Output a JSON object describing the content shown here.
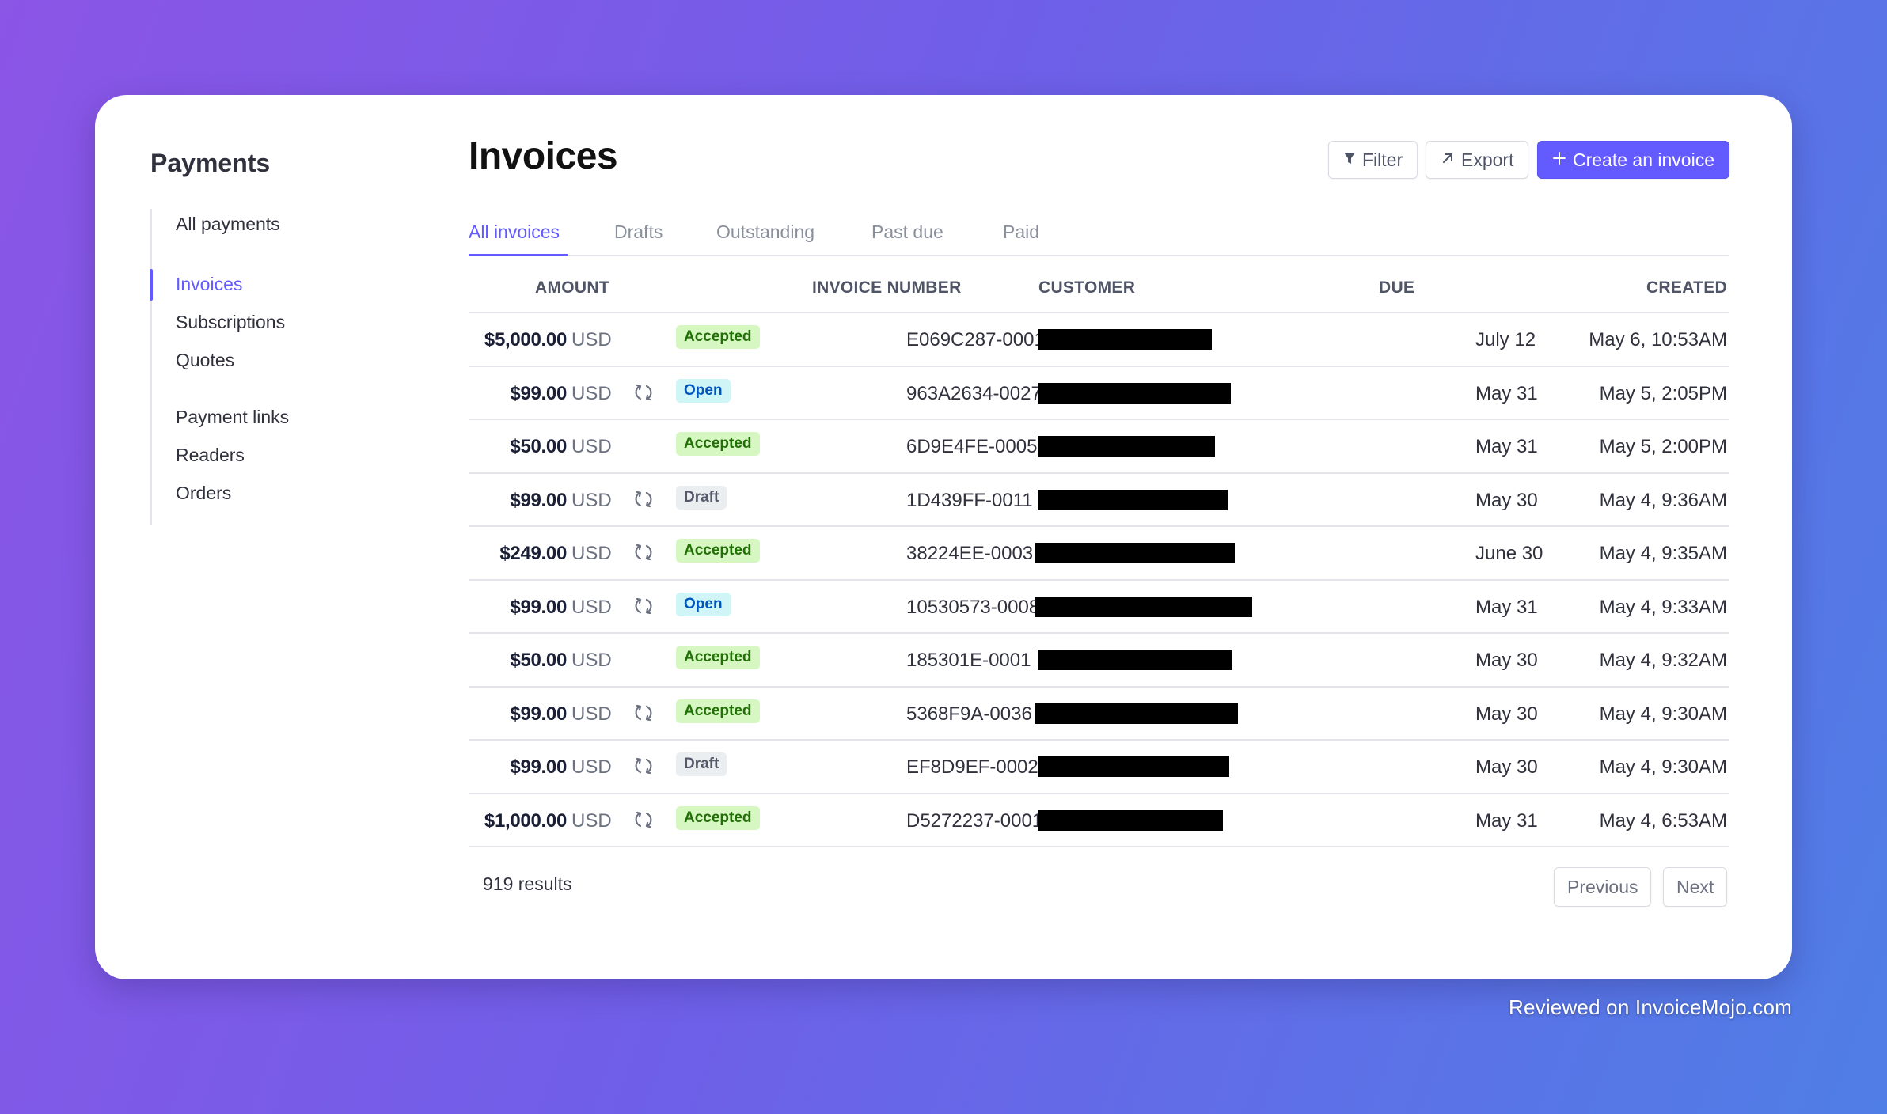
{
  "sidebar": {
    "title": "Payments",
    "items": [
      {
        "label": "All payments",
        "active": false
      },
      {
        "label": "Invoices",
        "active": true
      },
      {
        "label": "Subscriptions",
        "active": false
      },
      {
        "label": "Quotes",
        "active": false
      },
      {
        "label": "Payment links",
        "active": false
      },
      {
        "label": "Readers",
        "active": false
      },
      {
        "label": "Orders",
        "active": false
      }
    ]
  },
  "header": {
    "title": "Invoices",
    "filter_label": "Filter",
    "export_label": "Export",
    "create_label": "Create an invoice"
  },
  "tabs": [
    {
      "label": "All invoices",
      "active": true
    },
    {
      "label": "Drafts",
      "active": false
    },
    {
      "label": "Outstanding",
      "active": false
    },
    {
      "label": "Past due",
      "active": false
    },
    {
      "label": "Paid",
      "active": false
    }
  ],
  "table": {
    "columns": [
      "AMOUNT",
      "INVOICE NUMBER",
      "CUSTOMER",
      "DUE",
      "CREATED"
    ],
    "rows": [
      {
        "amount": "$5,000.00",
        "currency": "USD",
        "recurring": false,
        "status": "Accepted",
        "invoice_number": "E069C287-0001",
        "due": "July 12",
        "created": "May 6, 10:53AM"
      },
      {
        "amount": "$99.00",
        "currency": "USD",
        "recurring": true,
        "status": "Open",
        "invoice_number": "963A2634-0027",
        "due": "May 31",
        "created": "May 5, 2:05PM"
      },
      {
        "amount": "$50.00",
        "currency": "USD",
        "recurring": false,
        "status": "Accepted",
        "invoice_number": "6D9E4FE-0005",
        "due": "May 31",
        "created": "May 5, 2:00PM"
      },
      {
        "amount": "$99.00",
        "currency": "USD",
        "recurring": true,
        "status": "Draft",
        "invoice_number": "1D439FF-0011",
        "due": "May 30",
        "created": "May 4, 9:36AM"
      },
      {
        "amount": "$249.00",
        "currency": "USD",
        "recurring": true,
        "status": "Accepted",
        "invoice_number": "38224EE-0003",
        "due": "June 30",
        "created": "May 4, 9:35AM"
      },
      {
        "amount": "$99.00",
        "currency": "USD",
        "recurring": true,
        "status": "Open",
        "invoice_number": "10530573-0008",
        "due": "May 31",
        "created": "May 4, 9:33AM"
      },
      {
        "amount": "$50.00",
        "currency": "USD",
        "recurring": false,
        "status": "Accepted",
        "invoice_number": "185301E-0001",
        "due": "May 30",
        "created": "May 4, 9:32AM"
      },
      {
        "amount": "$99.00",
        "currency": "USD",
        "recurring": true,
        "status": "Accepted",
        "invoice_number": "5368F9A-0036",
        "due": "May 30",
        "created": "May 4, 9:30AM"
      },
      {
        "amount": "$99.00",
        "currency": "USD",
        "recurring": true,
        "status": "Draft",
        "invoice_number": "EF8D9EF-0002",
        "due": "May 30",
        "created": "May 4, 9:30AM"
      },
      {
        "amount": "$1,000.00",
        "currency": "USD",
        "recurring": true,
        "status": "Accepted",
        "invoice_number": "D5272237-0001",
        "due": "May 31",
        "created": "May 4, 6:53AM"
      }
    ]
  },
  "footer": {
    "results": "919 results",
    "previous_label": "Previous",
    "next_label": "Next"
  },
  "watermark": "Reviewed on InvoiceMojo.com",
  "colors": {
    "accent": "#635bff",
    "accepted_bg": "#d7f7c2",
    "accepted_text": "#217005",
    "open_bg": "#cff5f6",
    "open_text": "#0055bc",
    "draft_bg": "#ebeef1",
    "draft_text": "#545969"
  },
  "icons": {
    "filter": "filter-icon",
    "export": "arrow-up-right-icon",
    "create": "plus-icon",
    "recurring": "recurring-icon"
  }
}
